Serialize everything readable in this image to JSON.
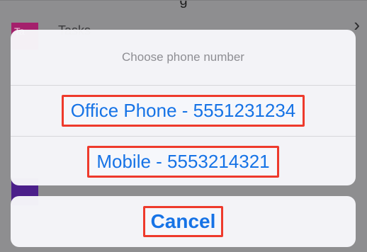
{
  "background": {
    "title_fragment": "g",
    "rows": [
      {
        "badge": "Ta",
        "badge_color": "#a4206c",
        "label": "Tasks"
      },
      {
        "badge": "",
        "badge_color": "#4b1f8a",
        "label": ""
      }
    ]
  },
  "action_sheet": {
    "title": "Choose phone number",
    "options": [
      {
        "label": "Office Phone - 5551231234"
      },
      {
        "label": "Mobile - 5553214321"
      }
    ],
    "cancel_label": "Cancel"
  },
  "colors": {
    "accent": "#1673e6",
    "highlight_border": "#ee3a2c"
  }
}
